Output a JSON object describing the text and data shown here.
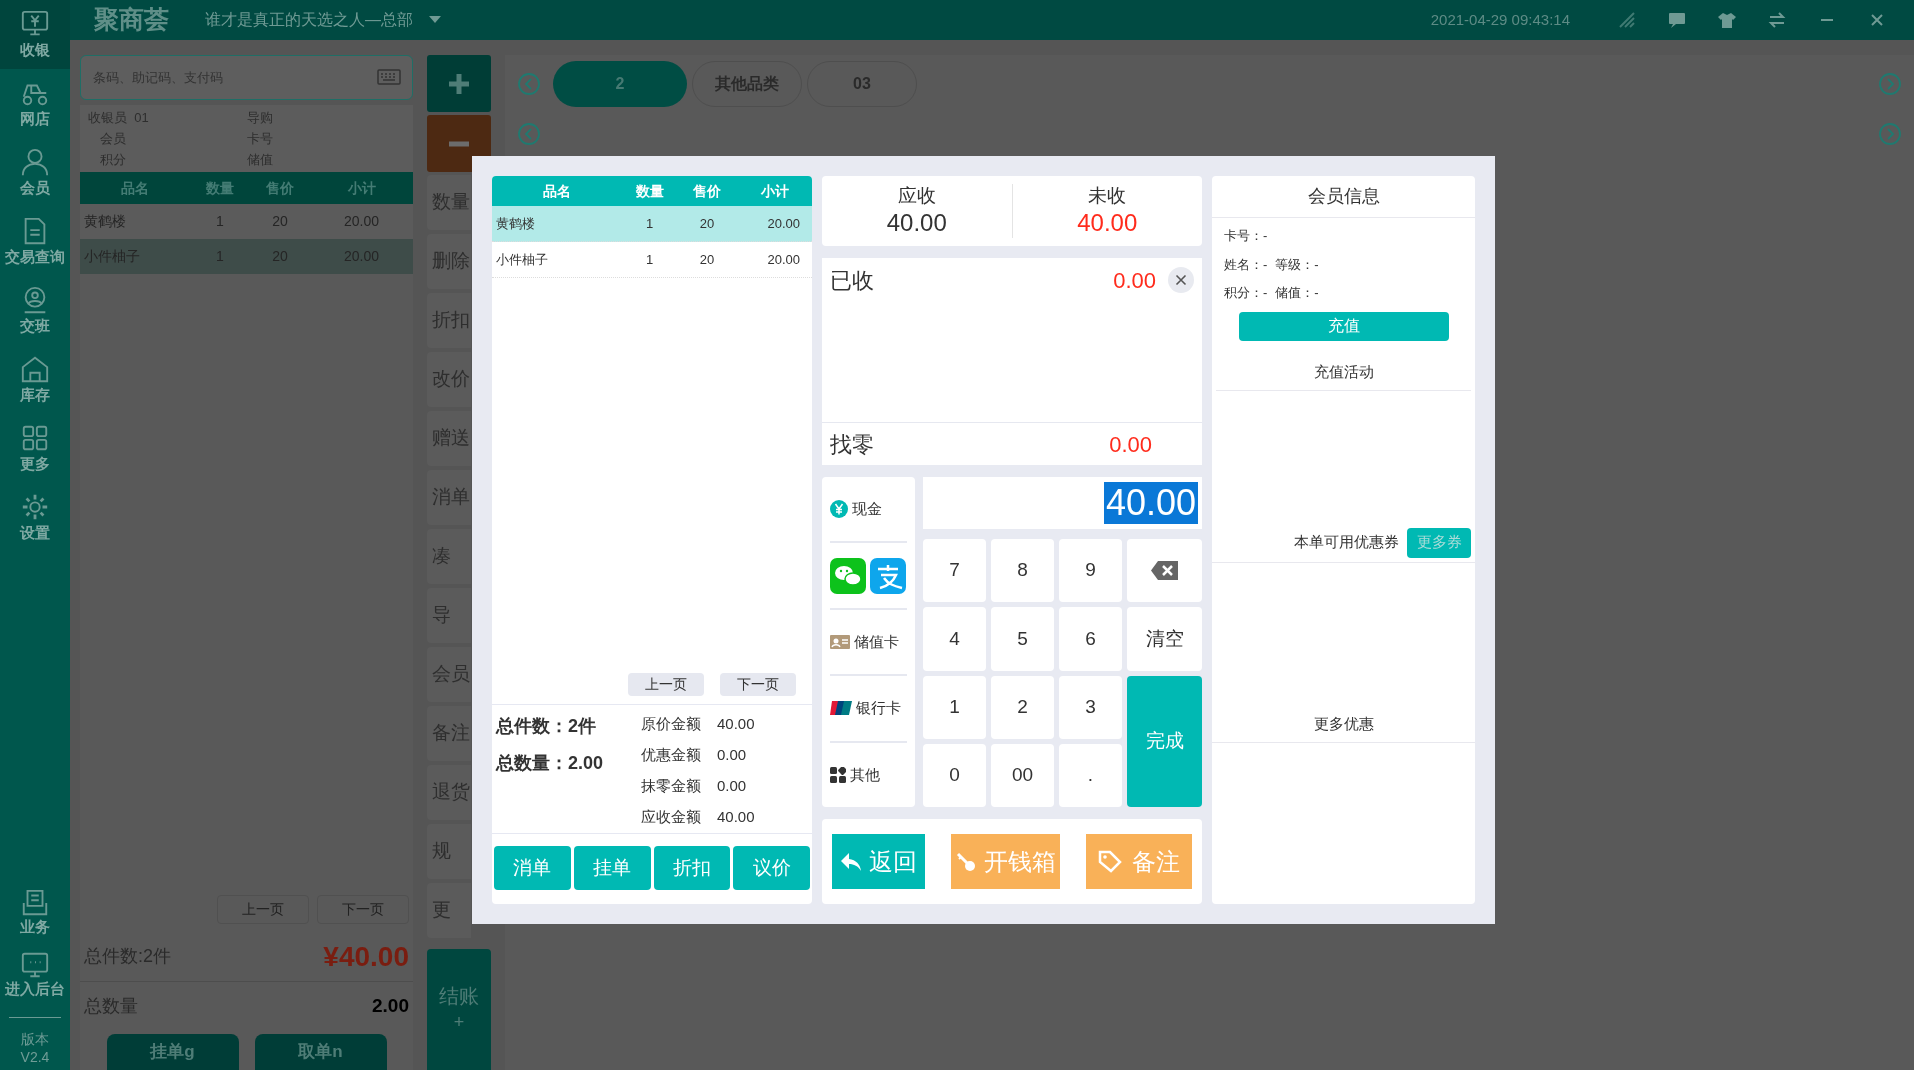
{
  "top_bar": {
    "logo": "聚商荟",
    "store": "谁才是真正的天选之人—总部",
    "datetime": "2021-04-29 09:43:14"
  },
  "sidebar": {
    "items": [
      {
        "label": "收银",
        "selected": true
      },
      {
        "label": "网店",
        "selected": false
      },
      {
        "label": "会员",
        "selected": false
      },
      {
        "label": "交易查询",
        "selected": false
      },
      {
        "label": "交班",
        "selected": false
      },
      {
        "label": "库存",
        "selected": false
      },
      {
        "label": "更多",
        "selected": false
      },
      {
        "label": "设置",
        "selected": false
      }
    ],
    "bottom_items": [
      {
        "label": "业务"
      },
      {
        "label": "进入后台"
      }
    ],
    "version": [
      "版本",
      "V2.4"
    ]
  },
  "order_panel": {
    "search": {
      "placeholder": "条码、助记码、支付码"
    },
    "info": [
      {
        "label": "收银员",
        "value": "01"
      },
      {
        "label": "导购"
      },
      {
        "label": "会员"
      },
      {
        "label": "卡号"
      },
      {
        "label": "积分"
      },
      {
        "label": "储值"
      }
    ],
    "columns": [
      "品名",
      "数量",
      "售价",
      "小计"
    ],
    "rows": [
      {
        "cells": [
          "黄鹤楼",
          "1",
          "20",
          "20.00"
        ],
        "selected": false
      },
      {
        "cells": [
          "小件柚子",
          "1",
          "20",
          "20.00"
        ],
        "selected": true
      }
    ],
    "pager": [
      "上一页",
      "下一页"
    ],
    "total_items": "总件数:2件",
    "total_amount": "¥40.00",
    "total_qty_label": "总数量",
    "total_qty": "2.00",
    "buttons": [
      "挂单g",
      "取单n"
    ]
  },
  "action_column": {
    "functions": [
      "数量",
      "删除",
      "折扣",
      "改价",
      "赠送",
      "消单",
      "凑",
      "导",
      "会员",
      "备注",
      "退货",
      "规",
      "更"
    ],
    "checkout": [
      "结账",
      "+"
    ]
  },
  "category_bar": {
    "tabs": [
      {
        "label": "2",
        "selected": true
      },
      {
        "label": "其他品类",
        "selected": false
      },
      {
        "label": "03",
        "selected": false
      }
    ]
  },
  "payment_dialog": {
    "items": {
      "columns": [
        "品名",
        "数量",
        "售价",
        "小计"
      ],
      "rows": [
        {
          "cells": [
            "黄鹤楼",
            "1",
            "20",
            "20.00"
          ],
          "selected": true
        },
        {
          "cells": [
            "小件柚子",
            "1",
            "20",
            "20.00"
          ],
          "selected": false
        }
      ],
      "pager": [
        "上一页",
        "下一页"
      ],
      "total_items": [
        "总件数：",
        "2件"
      ],
      "total_qty": [
        "总数量：",
        "2.00"
      ],
      "amounts": [
        {
          "label": "原价金额",
          "value": "40.00"
        },
        {
          "label": "优惠金额",
          "value": "0.00"
        },
        {
          "label": "抹零金额",
          "value": "0.00"
        },
        {
          "label": "应收金额",
          "value": "40.00"
        }
      ],
      "buttons": [
        "消单",
        "挂单",
        "折扣",
        "议价"
      ]
    },
    "due": {
      "label": "应收",
      "value": "40.00"
    },
    "unpaid": {
      "label": "未收",
      "value": "40.00"
    },
    "received": {
      "label": "已收",
      "value": "0.00"
    },
    "change": {
      "label": "找零",
      "value": "0.00"
    },
    "methods": [
      {
        "kind": "cash",
        "label": "现金"
      },
      {
        "kind": "wallets"
      },
      {
        "kind": "stored_card",
        "label": "储值卡"
      },
      {
        "kind": "bank_card",
        "label": "银行卡"
      },
      {
        "kind": "other",
        "label": "其他"
      }
    ],
    "amount_input": "40.00",
    "keys": [
      {
        "kind": "digit",
        "label": "7"
      },
      {
        "kind": "digit",
        "label": "8"
      },
      {
        "kind": "digit",
        "label": "9"
      },
      {
        "kind": "backspace"
      },
      {
        "kind": "digit",
        "label": "4"
      },
      {
        "kind": "digit",
        "label": "5"
      },
      {
        "kind": "digit",
        "label": "6"
      },
      {
        "kind": "clear",
        "label": "清空"
      },
      {
        "kind": "digit",
        "label": "1"
      },
      {
        "kind": "digit",
        "label": "2"
      },
      {
        "kind": "digit",
        "label": "3"
      },
      {
        "kind": "done",
        "label": "完成"
      },
      {
        "kind": "digit",
        "label": "0"
      },
      {
        "kind": "digit",
        "label": "00"
      },
      {
        "kind": "digit",
        "label": "."
      }
    ],
    "actions": [
      {
        "kind": "back",
        "label": "返回"
      },
      {
        "kind": "drawer",
        "label": "开钱箱"
      },
      {
        "kind": "note",
        "label": "备注"
      }
    ],
    "member": {
      "title": "会员信息",
      "lines": [
        [
          "卡号：-"
        ],
        [
          "姓名：-",
          "等级：-"
        ],
        [
          "积分：-",
          "储值：-"
        ]
      ],
      "recharge": "充值",
      "recharge_activity": "充值活动",
      "coupons": "本单可用优惠券",
      "more_coupons": "更多券",
      "more_offers": "更多优惠"
    }
  }
}
